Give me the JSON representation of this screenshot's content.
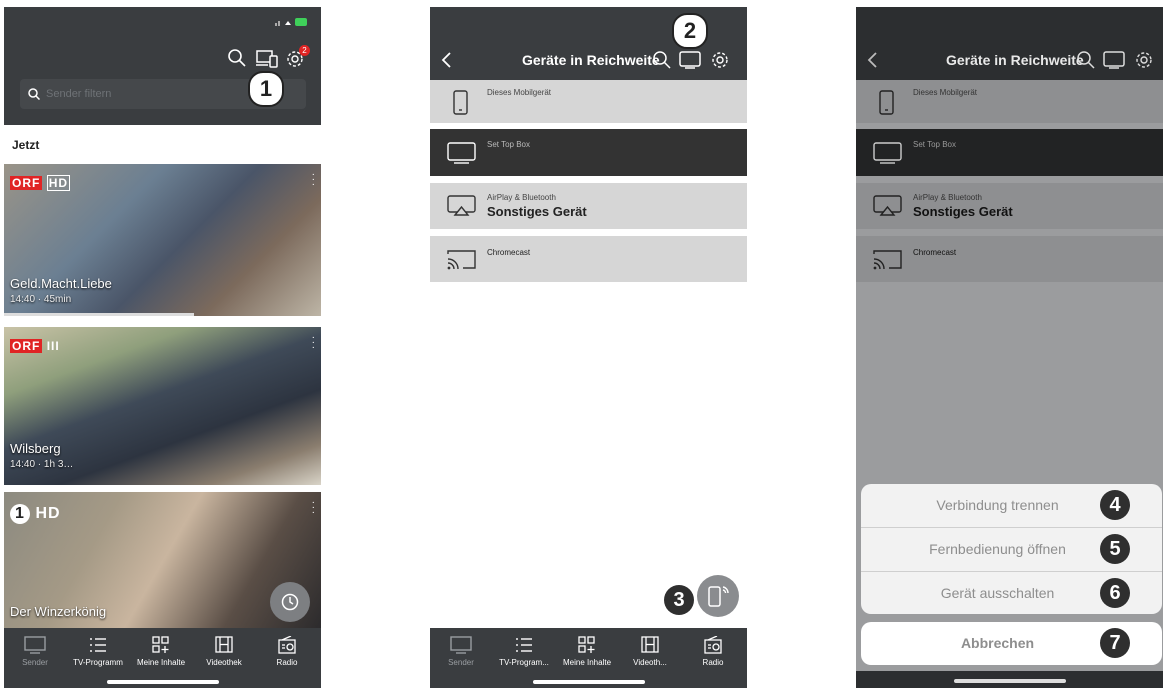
{
  "phone1": {
    "search_placeholder": "Sender filtern",
    "settings_badge": "2",
    "section_label": "Jetzt",
    "callout": "1",
    "cards": [
      {
        "logo": "ORF",
        "logo_suffix": "HD",
        "title": "Geld.Macht.Liebe",
        "time": "14:40 · 45min"
      },
      {
        "logo": "ORF",
        "logo_suffix": "III",
        "title": "Wilsberg",
        "time": "14:40 · 1h 3…"
      },
      {
        "logo": "1",
        "logo_suffix": "HD",
        "title": "Der Winzerkönig",
        "time": ""
      }
    ]
  },
  "phone2": {
    "title": "Geräte in Reichweite",
    "callout_top": "2",
    "callout_bottom": "3",
    "devices": [
      {
        "small": "Dieses Mobilgerät",
        "big": "",
        "icon": "phone-icon"
      },
      {
        "small": "Set Top Box",
        "big": "",
        "icon": "tv-icon"
      },
      {
        "small": "AirPlay & Bluetooth",
        "big": "Sonstiges Gerät",
        "icon": "airplay-icon"
      },
      {
        "small": "Chromecast",
        "big": "",
        "icon": "cast-icon"
      }
    ]
  },
  "phone3": {
    "title": "Geräte in Reichweite",
    "actions": [
      {
        "label": "Verbindung trennen",
        "num": "4"
      },
      {
        "label": "Fernbedienung öffnen",
        "num": "5"
      },
      {
        "label": "Gerät ausschalten",
        "num": "6"
      }
    ],
    "cancel": {
      "label": "Abbrechen",
      "num": "7"
    }
  },
  "tabbar1": [
    "Sender",
    "TV-Programm",
    "Meine Inhalte",
    "Videothek",
    "Radio"
  ],
  "tabbar2": [
    "Sender",
    "TV-Program...",
    "Meine Inhalte",
    "Videoth...",
    "Radio"
  ],
  "colors": {
    "dark": "#3a3d40",
    "accent_badge": "#e02424",
    "row_light": "#d6d6d6",
    "row_selected": "#333333"
  }
}
